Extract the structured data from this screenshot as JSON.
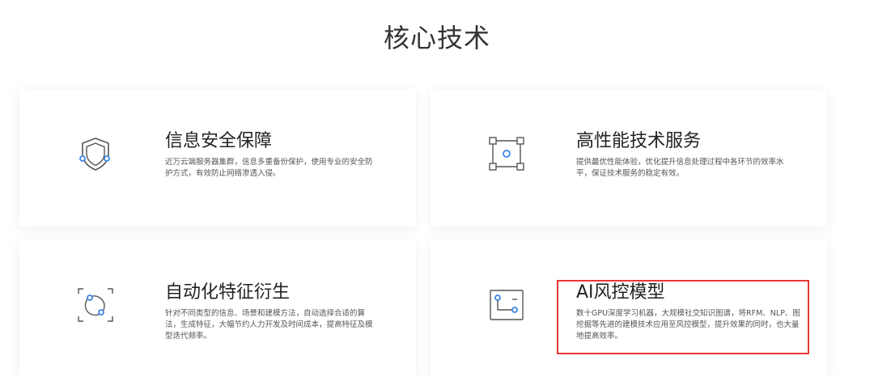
{
  "page": {
    "title": "核心技术"
  },
  "colors": {
    "accent_blue": "#3b86e8",
    "icon_gray": "#555555",
    "highlight_red": "#e53935"
  },
  "cards": [
    {
      "icon": "shield-icon",
      "title": "信息安全保障",
      "description": "近万云端服务器集群，信息多重备份保护，使用专业的安全防护方式，有效防止网络渗透入侵。"
    },
    {
      "icon": "performance-nodes-icon",
      "title": "高性能技术服务",
      "description": "提供最优性能体验，优化提升信息处理过程中各环节的效率水平，保证技术服务的稳定有效。"
    },
    {
      "icon": "auto-feature-icon",
      "title": "自动化特征衍生",
      "description": "针对不同类型的信息、场景和建模方法，自动选择合适的算法，生成特征，大幅节约人力开发及时间成本，提高特征及模型迭代频率。"
    },
    {
      "icon": "ai-model-icon",
      "title": "AI风控模型",
      "description": "数十GPU深度学习机器，大规模社交知识图谱，将RFM、NLP、图挖掘等先进的建模技术应用至风控模型，提升效果的同时，也大量地提高效率。"
    }
  ]
}
